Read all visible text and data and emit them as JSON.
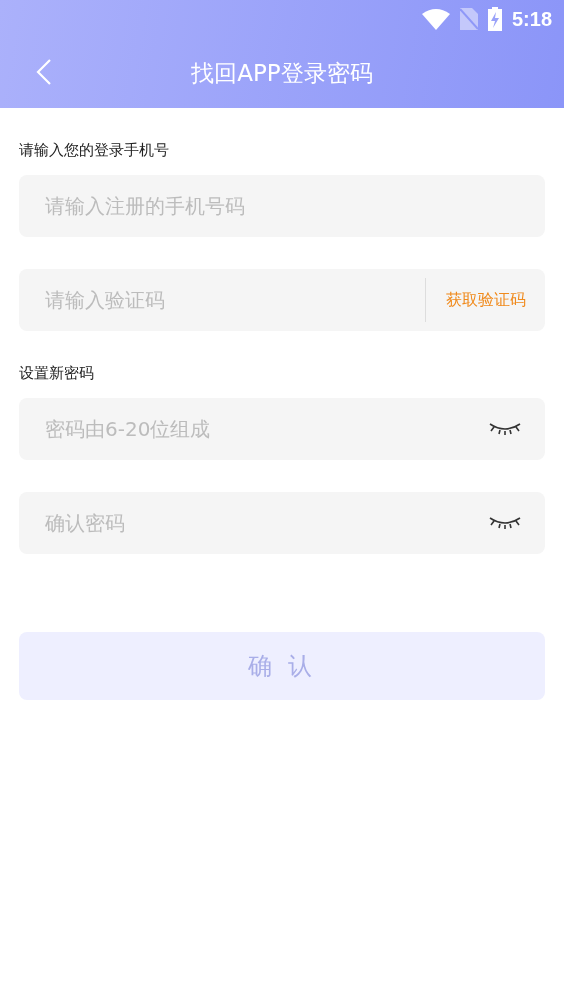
{
  "status_bar": {
    "time": "5:18"
  },
  "header": {
    "title": "找回APP登录密码"
  },
  "sections": [
    {
      "label": "请输入您的登录手机号",
      "fields": [
        {
          "kind": "text",
          "placeholder": "请输入注册的手机号码"
        },
        {
          "kind": "code",
          "placeholder": "请输入验证码",
          "action": "获取验证码"
        }
      ]
    },
    {
      "label": "设置新密码",
      "fields": [
        {
          "kind": "password",
          "placeholder": "密码由6-20位组成"
        },
        {
          "kind": "password",
          "placeholder": "确认密码"
        }
      ]
    }
  ],
  "confirm_button": {
    "label": "确 认",
    "disabled": true
  }
}
